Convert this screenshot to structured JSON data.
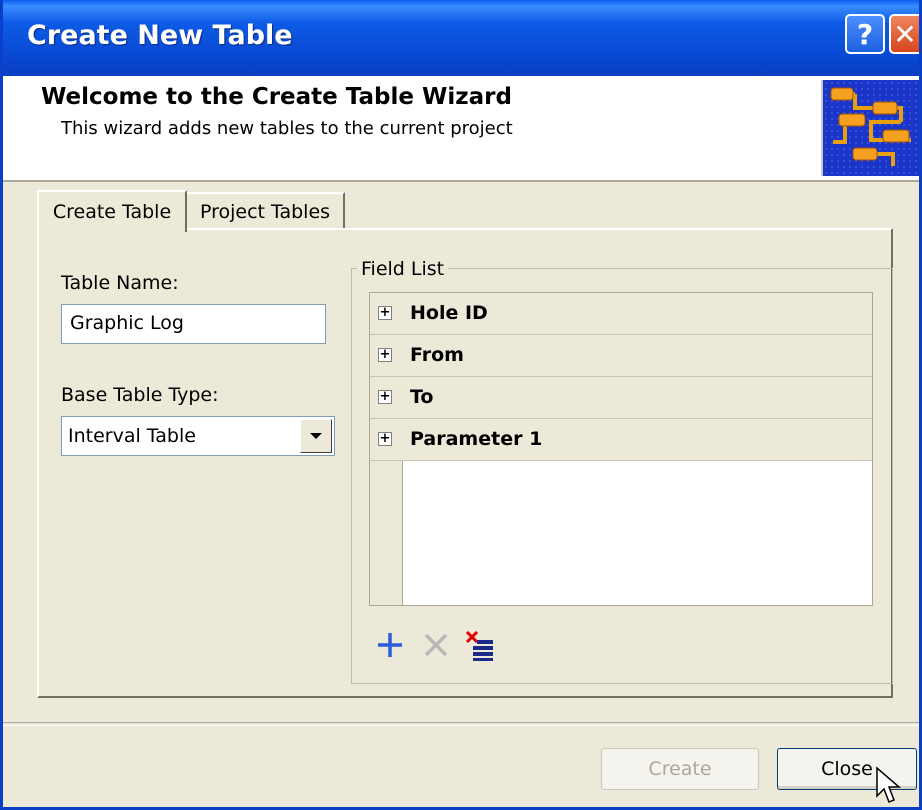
{
  "window": {
    "title": "Create New Table",
    "help_glyph": "?",
    "close_glyph": "✕"
  },
  "header": {
    "title": "Welcome to the Create Table Wizard",
    "subtitle": "This wizard adds new tables to the current project",
    "logo_icon": "wizard-flowchart-icon"
  },
  "tabs": [
    {
      "label": "Create Table",
      "active": true
    },
    {
      "label": "Project Tables",
      "active": false
    }
  ],
  "form": {
    "table_name_label": "Table Name:",
    "table_name_value": "Graphic Log",
    "base_type_label": "Base Table Type:",
    "base_type_value": "Interval Table"
  },
  "field_list": {
    "label": "Field List",
    "fields": [
      {
        "label": "Hole ID",
        "expander": "+"
      },
      {
        "label": "From",
        "expander": "+"
      },
      {
        "label": "To",
        "expander": "+"
      },
      {
        "label": "Parameter 1",
        "expander": "+"
      }
    ],
    "toolbar": [
      "add-field-icon",
      "delete-field-icon",
      "clear-fields-icon"
    ]
  },
  "buttons": {
    "create": "Create",
    "close": "Close"
  },
  "colors": {
    "titlebar": "#0a5cf0",
    "window_bg": "#ece9d8",
    "add_icon": "#2a5fd8",
    "delete_icon": "#b8b8b8",
    "clear_icon_red": "#e00000",
    "clear_icon_blue": "#1a2a8a"
  }
}
